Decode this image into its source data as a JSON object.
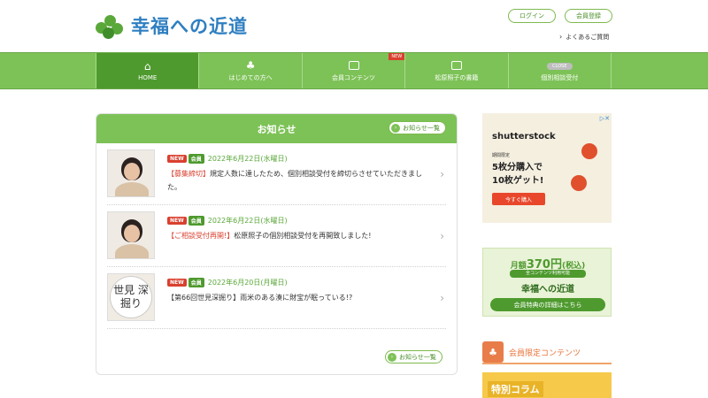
{
  "header": {
    "logo_text": "幸福への近道",
    "login_label": "ログイン",
    "register_label": "会員登録",
    "faq_label": "よくあるご質問"
  },
  "nav": {
    "items": [
      {
        "label": "HOME",
        "icon": "home-icon",
        "active": true
      },
      {
        "label": "はじめての方へ",
        "icon": "clover-icon"
      },
      {
        "label": "会員コンテンツ",
        "icon": "member-card-icon",
        "badge": "NEW"
      },
      {
        "label": "松原照子の書籍",
        "icon": "book-icon"
      },
      {
        "label": "個別相談受付",
        "icon": "consult-icon",
        "badge": "CLOSE"
      }
    ]
  },
  "news": {
    "title": "お知らせ",
    "list_button": "お知らせ一覧",
    "items": [
      {
        "tag_new": "NEW",
        "tag_member": "会員",
        "date": "2022年6月22日(水曜日)",
        "highlight": "【募集締切】",
        "text": "規定人数に達したため、個別相談受付を締切らさせていただきました。",
        "thumb": "portrait"
      },
      {
        "tag_new": "NEW",
        "tag_member": "会員",
        "date": "2022年6月22日(水曜日)",
        "highlight": "【ご相談受付再開!】",
        "text": "松原照子の個別相談受付を再開致しました!",
        "thumb": "portrait"
      },
      {
        "tag_new": "NEW",
        "tag_member": "会員",
        "date": "2022年6月20日(月曜日)",
        "highlight": "",
        "text": "【第66回世見深掘り】雨米のある湊に財宝が眠っている!?",
        "thumb": "世見 深掘り"
      }
    ]
  },
  "ads": {
    "shutterstock": {
      "brand": "shutterstock",
      "sub": "期間限定",
      "main_line1": "5枚分購入で",
      "main_line2": "10枚ゲット!",
      "button": "今すぐ購入"
    },
    "membership": {
      "price_prefix": "月額",
      "price": "370円",
      "price_suffix": "(税込)",
      "sub": "全コンテンツ利用可能",
      "logo": "幸福への近道",
      "button": "会員特典の詳細はこちら"
    }
  },
  "members": {
    "title": "会員限定コンテンツ",
    "special_label": "特別コラム"
  },
  "colors": {
    "green": "#7dc257",
    "dark_green": "#4e9a2e",
    "red": "#d9402f",
    "orange": "#e8743a"
  }
}
